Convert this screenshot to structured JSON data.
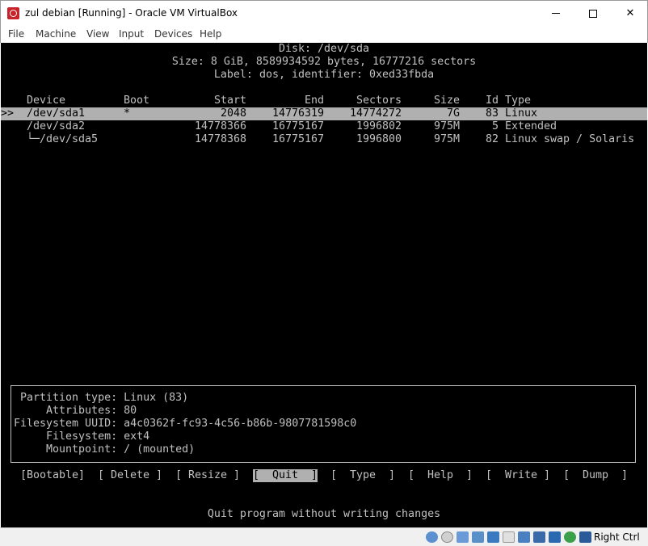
{
  "window": {
    "title": "zul debian [Running] - Oracle VM VirtualBox",
    "minimize_glyph": "",
    "maximize_glyph": "",
    "close_glyph": "✕"
  },
  "menu": [
    "File",
    "Machine",
    "View",
    "Input",
    "Devices",
    "Help"
  ],
  "disk": {
    "title": "Disk: /dev/sda",
    "size_line": "Size: 8 GiB, 8589934592 bytes, 16777216 sectors",
    "label_line": "Label: dos, identifier: 0xed33fbda"
  },
  "table": {
    "headers": {
      "device": "Device",
      "boot": "Boot",
      "start": "Start",
      "end": "End",
      "sectors": "Sectors",
      "size": "Size",
      "id": "Id",
      "type": "Type"
    },
    "selector": ">>",
    "rows": [
      {
        "device": "/dev/sda1",
        "boot": "*",
        "start": "2048",
        "end": "14776319",
        "sectors": "14774272",
        "size": "7G",
        "id": "83",
        "type": "Linux"
      },
      {
        "device": "/dev/sda2",
        "boot": "",
        "start": "14778366",
        "end": "16775167",
        "sectors": "1996802",
        "size": "975M",
        "id": "5",
        "type": "Extended"
      },
      {
        "device": "└─/dev/sda5",
        "boot": "",
        "start": "14778368",
        "end": "16775167",
        "sectors": "1996800",
        "size": "975M",
        "id": "82",
        "type": "Linux swap / Solaris"
      }
    ]
  },
  "info": {
    "partition_type": "Partition type: Linux (83)",
    "attributes": "    Attributes: 80",
    "fs_uuid": "Filesystem UUID: a4c0362f-fc93-4c56-b86b-9807781598c0",
    "filesystem": "     Filesystem: ext4",
    "mountpoint": "     Mountpoint: / (mounted)"
  },
  "actions": {
    "bootable": "[Bootable]",
    "delete": "[ Delete ]",
    "resize": "[ Resize ]",
    "quit": "[  Quit  ]",
    "type": "[  Type  ]",
    "help": "[  Help  ]",
    "write": "[  Write ]",
    "dump": "[  Dump  ]"
  },
  "status_message": "Quit program without writing changes",
  "statusbar": {
    "right_ctrl": "Right Ctrl",
    "icons": [
      "hard-disk-icon",
      "optical-drive-icon",
      "audio-icon",
      "network-icon",
      "usb-icon",
      "shared-folders-icon",
      "display-icon",
      "video-capture-icon",
      "cpu-icon",
      "mouse-integration-icon",
      "keyboard-icon"
    ]
  }
}
